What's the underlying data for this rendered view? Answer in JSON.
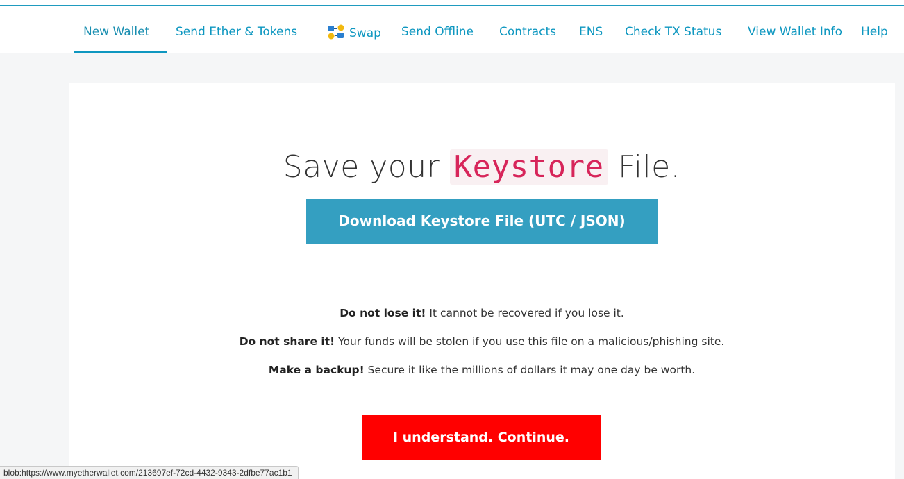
{
  "nav": {
    "items": [
      {
        "label": "New Wallet",
        "active": true
      },
      {
        "label": "Send Ether & Tokens"
      },
      {
        "label": "Swap",
        "icon": "swap-icon"
      },
      {
        "label": "Send Offline"
      },
      {
        "label": "Contracts"
      },
      {
        "label": "ENS"
      },
      {
        "label": "Check TX Status"
      },
      {
        "label": "View Wallet Info"
      },
      {
        "label": "Help"
      }
    ]
  },
  "main": {
    "title_prefix": "Save your ",
    "title_code": "Keystore",
    "title_suffix": " File.",
    "download_button_label": "Download Keystore File (UTC / JSON)",
    "warnings": [
      {
        "bold": "Do not lose it!",
        "text": " It cannot be recovered if you lose it."
      },
      {
        "bold": "Do not share it!",
        "text": " Your funds will be stolen if you use this file on a malicious/phishing site."
      },
      {
        "bold": "Make a backup!",
        "text": " Secure it like the millions of dollars it may one day be worth."
      }
    ],
    "continue_button_label": "I understand. Continue."
  },
  "status_bar": {
    "url": "blob:https://www.myetherwallet.com/213697ef-72cd-4432-9343-2dfbe77ac1b1"
  },
  "colors": {
    "accent": "#0e97c0",
    "download_button": "#349fc1",
    "continue_button": "#ff0000",
    "code_text": "#d7255a"
  }
}
